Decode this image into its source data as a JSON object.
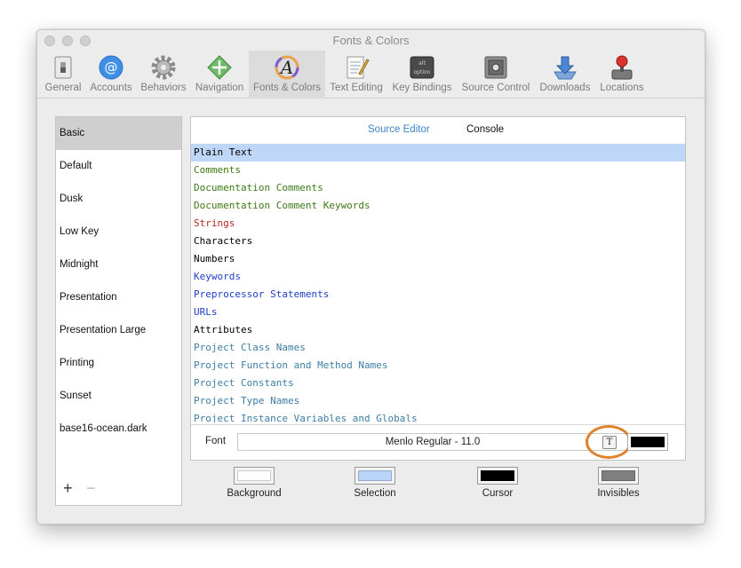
{
  "window": {
    "title": "Fonts & Colors"
  },
  "toolbar": {
    "items": [
      {
        "label": "General",
        "icon": "general-switch-icon"
      },
      {
        "label": "Accounts",
        "icon": "at-sign-icon"
      },
      {
        "label": "Behaviors",
        "icon": "gear-icon"
      },
      {
        "label": "Navigation",
        "icon": "navigation-arrows-icon"
      },
      {
        "label": "Fonts & Colors",
        "icon": "font-a-icon"
      },
      {
        "label": "Text Editing",
        "icon": "notepad-pencil-icon"
      },
      {
        "label": "Key Bindings",
        "icon": "keyboard-keys-icon"
      },
      {
        "label": "Source Control",
        "icon": "safe-icon"
      },
      {
        "label": "Downloads",
        "icon": "download-tray-icon"
      },
      {
        "label": "Locations",
        "icon": "joystick-icon"
      }
    ],
    "active_index": 4
  },
  "themes": {
    "items": [
      "Basic",
      "Default",
      "Dusk",
      "Low Key",
      "Midnight",
      "Presentation",
      "Presentation Large",
      "Printing",
      "Sunset",
      "base16-ocean.dark"
    ],
    "selected_index": 0,
    "add_label": "+",
    "remove_label": "−"
  },
  "editor": {
    "tabs": [
      {
        "label": "Source Editor",
        "active": true
      },
      {
        "label": "Console",
        "active": false
      }
    ],
    "syntax_items": [
      {
        "label": "Plain Text",
        "color": "#000000"
      },
      {
        "label": "Comments",
        "color": "#3d7a16"
      },
      {
        "label": "Documentation Comments",
        "color": "#3d7a16"
      },
      {
        "label": "Documentation Comment Keywords",
        "color": "#3d7a16"
      },
      {
        "label": "Strings",
        "color": "#b32a24"
      },
      {
        "label": "Characters",
        "color": "#000000"
      },
      {
        "label": "Numbers",
        "color": "#000000"
      },
      {
        "label": "Keywords",
        "color": "#1f3dc9"
      },
      {
        "label": "Preprocessor Statements",
        "color": "#1f3dc9"
      },
      {
        "label": "URLs",
        "color": "#1f3dc9"
      },
      {
        "label": "Attributes",
        "color": "#000000"
      },
      {
        "label": "Project Class Names",
        "color": "#3e7ea3"
      },
      {
        "label": "Project Function and Method Names",
        "color": "#3e7ea3"
      },
      {
        "label": "Project Constants",
        "color": "#3e7ea3"
      },
      {
        "label": "Project Type Names",
        "color": "#3e7ea3"
      },
      {
        "label": "Project Instance Variables and Globals",
        "color": "#3e7ea3"
      }
    ],
    "selected_index": 0,
    "font_label": "Font",
    "font_value": "Menlo Regular - 11.0",
    "font_button_glyph": "T",
    "text_color": "#000000"
  },
  "wells": [
    {
      "label": "Background",
      "color": "#ffffff"
    },
    {
      "label": "Selection",
      "color": "#b9d4f7"
    },
    {
      "label": "Cursor",
      "color": "#000000"
    },
    {
      "label": "Invisibles",
      "color": "#7f7f7f"
    }
  ],
  "colors": {
    "accent": "#3e86c7",
    "highlight_ring": "#e0822b"
  }
}
